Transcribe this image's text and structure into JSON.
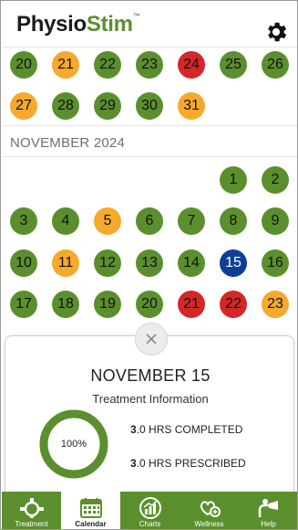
{
  "header": {
    "logo_part1": "Physio",
    "logo_part2": "Stim",
    "logo_tm": "™"
  },
  "prev_month_days": [
    {
      "day": "20",
      "status": "green"
    },
    {
      "day": "21",
      "status": "orange"
    },
    {
      "day": "22",
      "status": "green"
    },
    {
      "day": "23",
      "status": "green"
    },
    {
      "day": "24",
      "status": "red"
    },
    {
      "day": "25",
      "status": "green"
    },
    {
      "day": "26",
      "status": "green"
    },
    {
      "day": "27",
      "status": "orange"
    },
    {
      "day": "28",
      "status": "green"
    },
    {
      "day": "29",
      "status": "green"
    },
    {
      "day": "30",
      "status": "green"
    },
    {
      "day": "31",
      "status": "orange"
    }
  ],
  "month_label": "NOVEMBER 2024",
  "nov_days": [
    {
      "day": "1",
      "status": "green"
    },
    {
      "day": "2",
      "status": "green"
    },
    {
      "day": "3",
      "status": "green"
    },
    {
      "day": "4",
      "status": "green"
    },
    {
      "day": "5",
      "status": "orange"
    },
    {
      "day": "6",
      "status": "green"
    },
    {
      "day": "7",
      "status": "green"
    },
    {
      "day": "8",
      "status": "green"
    },
    {
      "day": "9",
      "status": "green"
    },
    {
      "day": "10",
      "status": "green"
    },
    {
      "day": "11",
      "status": "orange"
    },
    {
      "day": "12",
      "status": "green"
    },
    {
      "day": "13",
      "status": "green"
    },
    {
      "day": "14",
      "status": "green"
    },
    {
      "day": "15",
      "status": "blue"
    },
    {
      "day": "16",
      "status": "green"
    },
    {
      "day": "17",
      "status": "green"
    },
    {
      "day": "18",
      "status": "green"
    },
    {
      "day": "19",
      "status": "green"
    },
    {
      "day": "20",
      "status": "green"
    },
    {
      "day": "21",
      "status": "red"
    },
    {
      "day": "22",
      "status": "red"
    },
    {
      "day": "23",
      "status": "orange"
    }
  ],
  "colors": {
    "green": "#5b8f2e",
    "orange": "#f6a92b",
    "red": "#d42727",
    "blue": "#0e3f94"
  },
  "panel": {
    "close_icon": "close-x-icon",
    "title": "NOVEMBER 15",
    "subtitle": "Treatment Information",
    "percent_label": "100%",
    "percent_value": 100,
    "completed_num": "3",
    "completed_rest": ".0 HRS COMPLETED",
    "prescribed_num": "3",
    "prescribed_rest": ".0 HRS PRESCRIBED"
  },
  "tabs": [
    {
      "label": "Treatment",
      "icon": "treatment-icon",
      "active": false
    },
    {
      "label": "Calendar",
      "icon": "calendar-icon",
      "active": true
    },
    {
      "label": "Charts",
      "icon": "charts-icon",
      "active": false
    },
    {
      "label": "Wellness",
      "icon": "wellness-icon",
      "active": false
    },
    {
      "label": "Help",
      "icon": "help-icon",
      "active": false
    }
  ]
}
